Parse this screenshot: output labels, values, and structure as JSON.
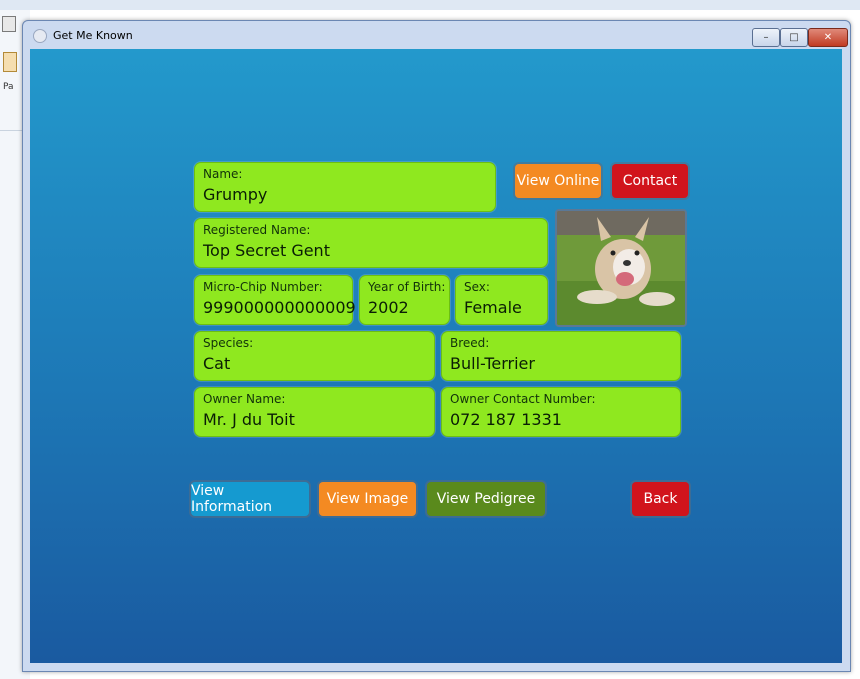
{
  "window": {
    "title": "Get Me Known",
    "minimize_label": "–",
    "maximize_label": "□",
    "close_label": "✕"
  },
  "background_app": {
    "fragment_text": "Pa"
  },
  "profile": {
    "name_label": "Name:",
    "name": "Grumpy",
    "registered_label": "Registered Name:",
    "registered": "Top Secret Gent",
    "chip_label": "Micro-Chip Number:",
    "chip": "999000000000009",
    "year_label": "Year of Birth:",
    "year": "2002",
    "sex_label": "Sex:",
    "sex": "Female",
    "species_label": "Species:",
    "species": "Cat",
    "breed_label": "Breed:",
    "breed": "Bull-Terrier",
    "owner_label": "Owner Name:",
    "owner": "Mr. J du Toit",
    "contact_label": "Owner Contact Number:",
    "contact": "072 187 1331"
  },
  "actions": {
    "view_online": "View Online",
    "contact": "Contact",
    "view_information": "View Information",
    "view_image": "View Image",
    "view_pedigree": "View Pedigree",
    "back": "Back"
  },
  "colors": {
    "card": "#8fe81f",
    "orange": "#f48a22",
    "red": "#d1141c",
    "blue": "#159ad0",
    "green": "#5a8a1c"
  }
}
